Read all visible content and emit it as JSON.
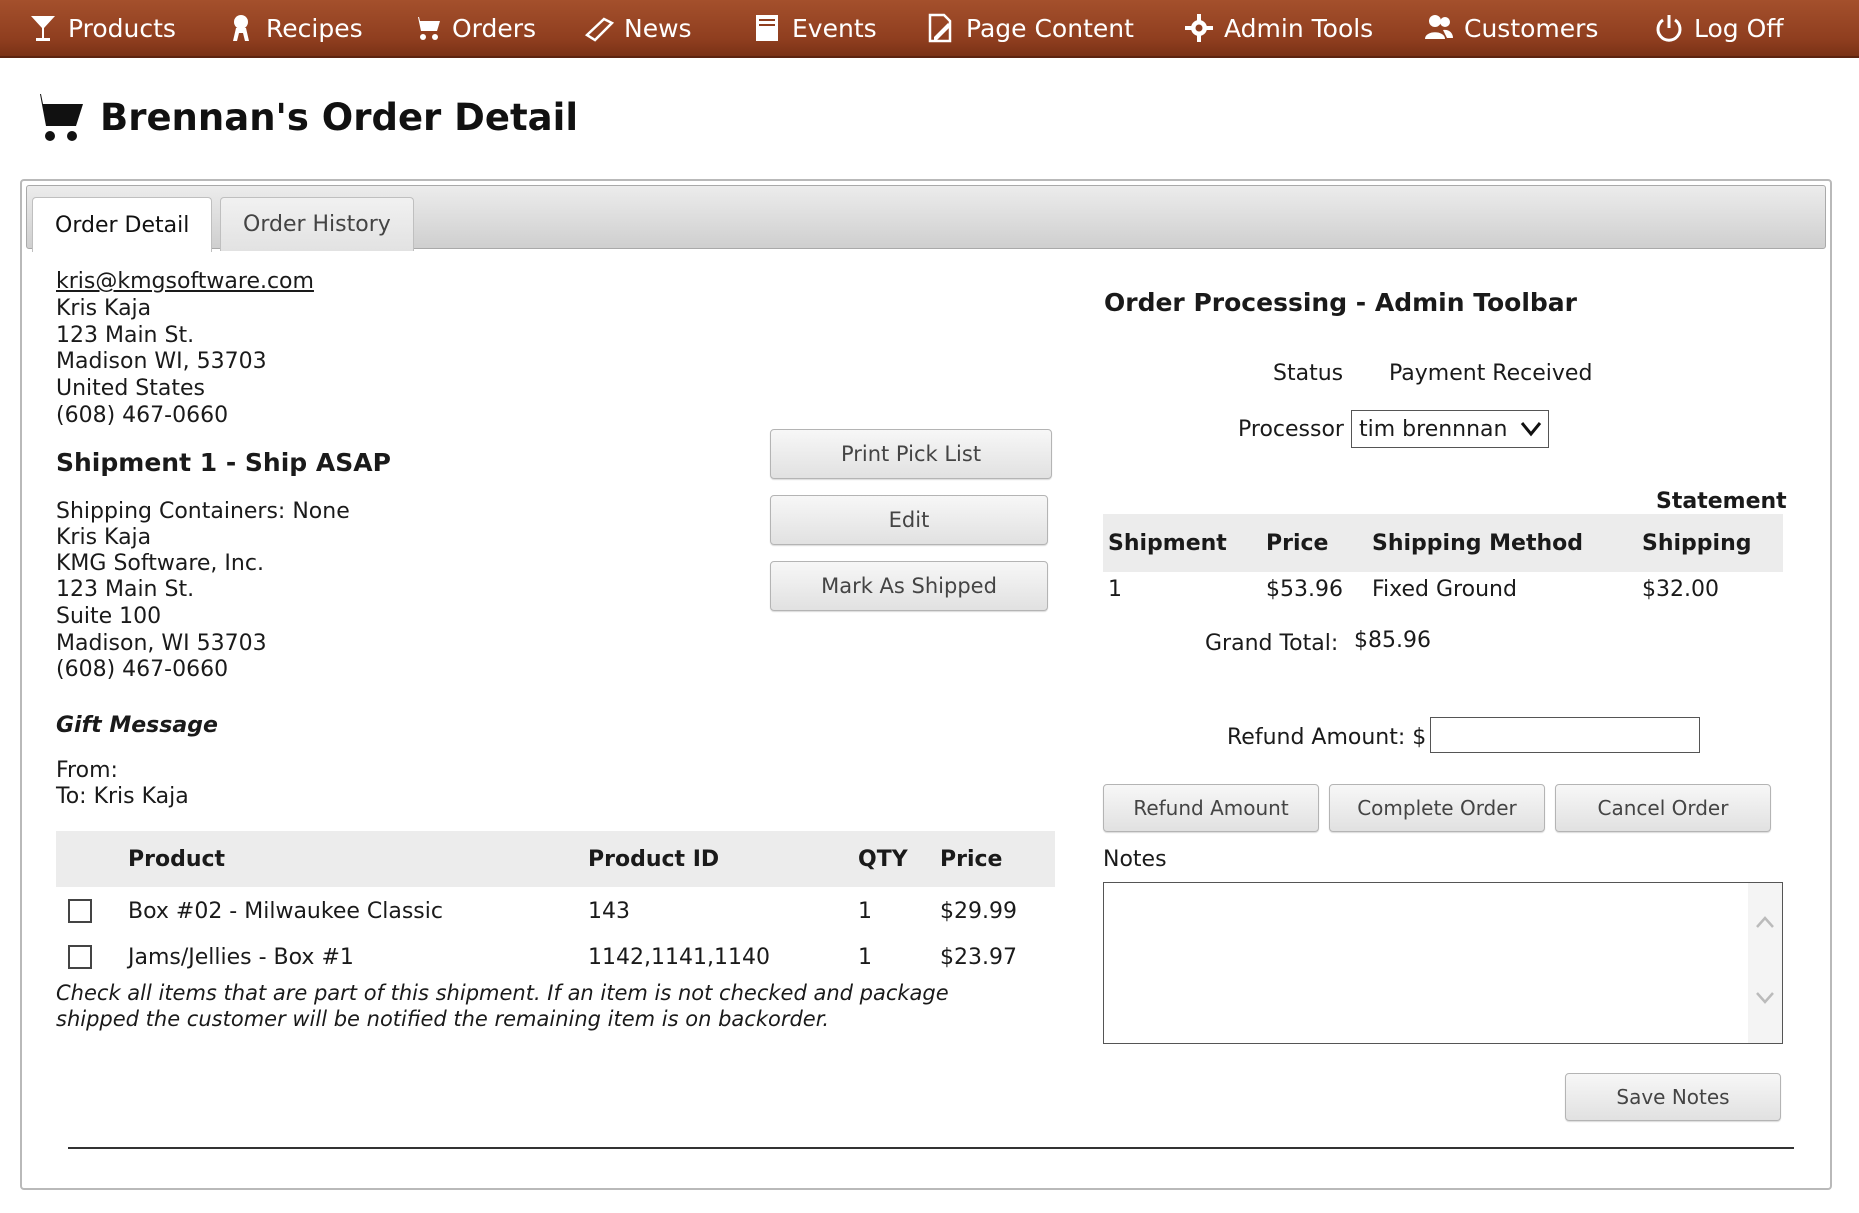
{
  "nav": {
    "products": "Products",
    "recipes": "Recipes",
    "orders": "Orders",
    "news": "News",
    "events": "Events",
    "page_content": "Page Content",
    "admin_tools": "Admin Tools",
    "customers": "Customers",
    "log_off": "Log Off"
  },
  "page": {
    "title": "Brennan's Order Detail"
  },
  "tabs": [
    {
      "label": "Order Detail",
      "active": true
    },
    {
      "label": "Order History",
      "active": false
    }
  ],
  "customer": {
    "email": "kris@kmgsoftware.com",
    "name": "Kris Kaja",
    "street": "123 Main St.",
    "city_state_zip": "Madison WI, 53703",
    "country": "United States",
    "phone": "(608) 467-0660"
  },
  "shipment": {
    "heading": "Shipment 1 - Ship ASAP",
    "containers": "Shipping Containers: None",
    "name": "Kris Kaja",
    "company": "KMG Software, Inc.",
    "street": "123 Main St.",
    "suite": "Suite 100",
    "city_state_zip": "Madison, WI 53703",
    "phone": "(608) 467-0660"
  },
  "shipment_buttons": {
    "print_pick_list": "Print Pick List",
    "edit": "Edit",
    "mark_as_shipped": "Mark As Shipped"
  },
  "gift": {
    "heading": "Gift Message",
    "from": "From:",
    "to": "To: Kris Kaja"
  },
  "products_table": {
    "headers": {
      "product": "Product",
      "product_id": "Product ID",
      "qty": "QTY",
      "price": "Price"
    },
    "rows": [
      {
        "product": "Box #02 - Milwaukee Classic",
        "product_id": "143",
        "qty": "1",
        "price": "$29.99",
        "checked": false
      },
      {
        "product": "Jams/Jellies - Box #1",
        "product_id": "1142,1141,1140",
        "qty": "1",
        "price": "$23.97",
        "checked": false
      }
    ],
    "note_line1": "Check all items that are part of this shipment. If an item is not checked and package",
    "note_line2": "shipped the customer will be notified the remaining item is on backorder."
  },
  "admin": {
    "heading": "Order Processing - Admin Toolbar",
    "status_label": "Status",
    "status_value": "Payment Received",
    "processor_label": "Processor",
    "processor_value": "tim brennnan"
  },
  "shipments_table": {
    "statement_label": "Statement",
    "headers": {
      "shipment": "Shipment",
      "price": "Price",
      "method": "Shipping Method",
      "shipping": "Shipping"
    },
    "rows": [
      {
        "shipment": "1",
        "price": "$53.96",
        "method": "Fixed Ground",
        "shipping": "$32.00"
      }
    ],
    "grand_total_label": "Grand Total:",
    "grand_total_value": "$85.96"
  },
  "refund": {
    "label": "Refund Amount: $",
    "value": ""
  },
  "order_buttons": {
    "refund_amount": "Refund Amount",
    "complete_order": "Complete Order",
    "cancel_order": "Cancel Order"
  },
  "notes": {
    "label": "Notes",
    "value": "",
    "save_button": "Save Notes"
  },
  "colors": {
    "nav_bar": "#9a4726",
    "table_header_bg": "#ececec"
  }
}
